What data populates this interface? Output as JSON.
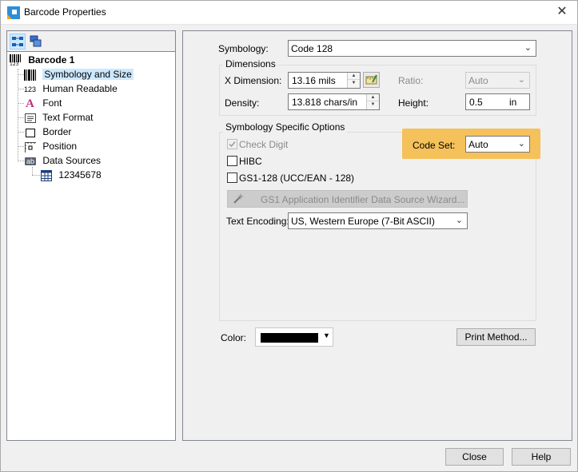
{
  "window": {
    "title": "Barcode Properties",
    "close_glyph": "✕"
  },
  "tree": {
    "root": "Barcode 1",
    "items": [
      {
        "label": "Symbology and Size",
        "icon": "barcode-bars-icon"
      },
      {
        "label": "Human Readable",
        "icon": "human-readable-123-icon"
      },
      {
        "label": "Font",
        "icon": "font-icon"
      },
      {
        "label": "Text Format",
        "icon": "text-format-icon"
      },
      {
        "label": "Border",
        "icon": "border-icon"
      },
      {
        "label": "Position",
        "icon": "position-icon"
      },
      {
        "label": "Data Sources",
        "icon": "data-sources-icon"
      }
    ],
    "data_source_child": "12345678",
    "root_icon_text": "123",
    "human_readable_icon_text": "123",
    "font_icon_text": "A",
    "data_sources_icon_text": "ab"
  },
  "main": {
    "symbology_label": "Symbology:",
    "symbology_value": "Code 128",
    "dimensions_title": "Dimensions",
    "x_dimension_label": "X Dimension:",
    "x_dimension_value": "13.16  mils",
    "ratio_label": "Ratio:",
    "ratio_value": "Auto",
    "density_label": "Density:",
    "density_value": "13.818  chars/in",
    "height_label": "Height:",
    "height_value": "0.5",
    "height_unit": "in",
    "options_title": "Symbology Specific Options",
    "check_digit_label": "Check Digit",
    "hibc_label": "HIBC",
    "gs1_label": "GS1-128 (UCC/EAN - 128)",
    "wizard_label": "GS1 Application Identifier Data Source Wizard...",
    "code_set_label": "Code Set:",
    "code_set_value": "Auto",
    "text_encoding_label": "Text Encoding:",
    "text_encoding_value": "US, Western Europe (7-Bit ASCII)",
    "color_label": "Color:",
    "color_value": "#000000",
    "print_method_label": "Print Method..."
  },
  "footer": {
    "close_label": "Close",
    "help_label": "Help"
  },
  "colors": {
    "highlight": "#f5c15a",
    "selection": "#cce8ff"
  }
}
